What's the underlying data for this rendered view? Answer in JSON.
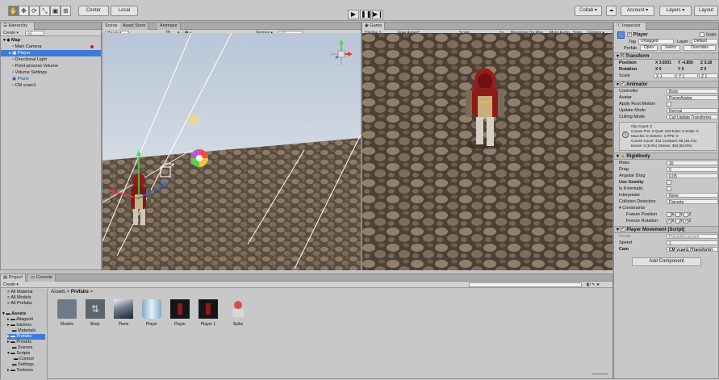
{
  "toolbar": {
    "tools": [
      "✋",
      "✥",
      "⟳",
      "⤡",
      "▣",
      "⊞"
    ],
    "pivot": "Center",
    "space": "Local",
    "collab": "Collab ▾",
    "account": "Account ▾",
    "layers": "Layers ▾",
    "layout": "Layout"
  },
  "hierarchy": {
    "tab": "Hierarchy",
    "create": "Create ▾",
    "search_placeholder": "All",
    "scene": "Map",
    "items": [
      "Main Camera",
      "Player",
      "Directional Light",
      "Point-process Volume",
      "Volume Settings",
      "Plane",
      "CM vcam1"
    ],
    "selected_index": 1
  },
  "scene_view": {
    "tabs": [
      "Scene",
      "Asset Store",
      "Animator"
    ],
    "shading": "Shaded",
    "mode": "2D",
    "gizmos": "Gizmos ▾",
    "search_placeholder": "All"
  },
  "game_view": {
    "tab": "Game",
    "display": "Display 1",
    "aspect": "Free Aspect",
    "scale_label": "Scale",
    "scale_value": "1x",
    "toggles": [
      "Maximize On Play",
      "Mute Audio",
      "Stats",
      "Gizmos ▾"
    ]
  },
  "inspector": {
    "tab": "Inspector",
    "object_name": "Player",
    "static": "Static",
    "tag_label": "Tag",
    "tag": "Untagged",
    "layer_label": "Layer",
    "layer": "Default",
    "prefab_label": "Prefab",
    "prefab_buttons": [
      "Open",
      "Select",
      "Overrides"
    ],
    "transform": {
      "title": "Transform",
      "position_label": "Position",
      "rotation_label": "Rotation",
      "scale_label": "Scale",
      "position": [
        "X 3.6931",
        "Y -4.859",
        "Z 3.18"
      ],
      "rotation": [
        "X 0",
        "Y 0",
        "Z 0"
      ],
      "scale": [
        "X 1",
        "Y 1",
        "Z 1"
      ]
    },
    "animator": {
      "title": "Animator",
      "rows": [
        {
          "label": "Controller",
          "value": "Body"
        },
        {
          "label": "Avatar",
          "value": "PlayerAvatar"
        },
        {
          "label": "Apply Root Motion",
          "value": ""
        },
        {
          "label": "Update Mode",
          "value": "Normal"
        },
        {
          "label": "Culling Mode",
          "value": "Cull Update Transforms"
        }
      ],
      "info": [
        "Clip Count: 2",
        "Curves Pos: 2 Quat: 134 Euler: 0 Scale: 0",
        "Muscles: 0 Generic: 0 PPtr: 0",
        "Curves Count: 422 Constant: 68 (16.1%)",
        "Dense: 0 (0.0%) Stream: 354 (83.9%)"
      ]
    },
    "rigidbody": {
      "title": "Rigidbody",
      "rows": [
        {
          "label": "Mass",
          "value": "10"
        },
        {
          "label": "Drag",
          "value": "0"
        },
        {
          "label": "Angular Drag",
          "value": "0.05"
        },
        {
          "label": "Use Gravity",
          "value": ""
        },
        {
          "label": "Is Kinematic",
          "value": ""
        },
        {
          "label": "Interpolate",
          "value": "None"
        },
        {
          "label": "Collision Detection",
          "value": "Discrete"
        }
      ],
      "constraints": "Constraints",
      "freeze_pos": "Freeze Position",
      "freeze_rot": "Freeze Rotation"
    },
    "player_movement": {
      "title": "Player Movement (Script)",
      "script_label": "Script",
      "script": "PlayerMovement",
      "speed_label": "Speed",
      "speed": "1",
      "cam_label": "Cam",
      "cam": "CM vcam1 (Transform)"
    },
    "add_component": "Add Component"
  },
  "project": {
    "tabs": [
      "Project",
      "Console"
    ],
    "create": "Create ▾",
    "breadcrumb": [
      "Assets",
      ">",
      "Prefabs",
      ">"
    ],
    "favorites": [
      "All Material",
      "All Models",
      "All Prefabs"
    ],
    "tree_root": "Assets",
    "tree": [
      "Aliaguriti",
      "Gizmos",
      "Materials",
      "Prefabs",
      "Presets",
      "Scenes",
      "Scripts",
      "Control",
      "Settings",
      "Textures"
    ],
    "assets": [
      "Models",
      "Body",
      "Plane",
      "Player",
      "Player",
      "Player 1",
      "Spike"
    ]
  }
}
